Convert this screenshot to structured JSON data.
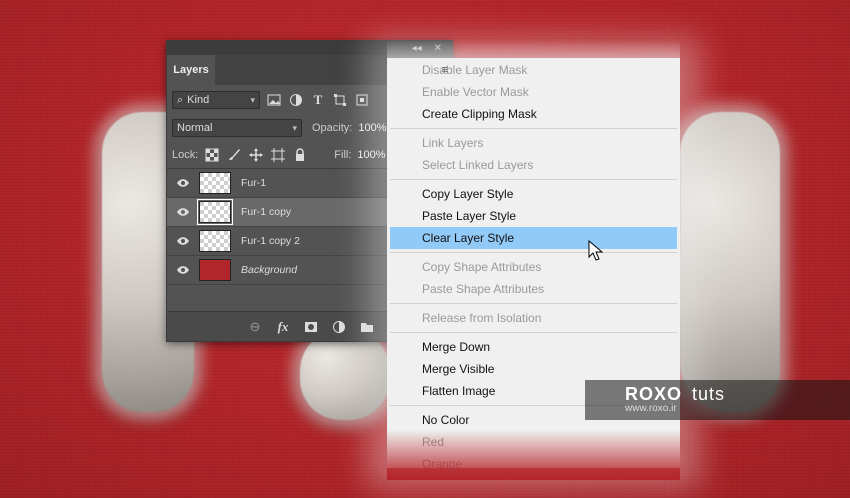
{
  "panel": {
    "title_tab": "Layers",
    "filter_kind": "Kind",
    "blend_mode": "Normal",
    "opacity_label": "Opacity:",
    "opacity_value": "100%",
    "lock_label": "Lock:",
    "fill_label": "Fill:",
    "fill_value": "100%",
    "layers": [
      {
        "name": "Fur-1",
        "thumb": "transparent",
        "selected": false,
        "italic": false
      },
      {
        "name": "Fur-1 copy",
        "thumb": "transparent",
        "selected": true,
        "italic": false
      },
      {
        "name": "Fur-1 copy 2",
        "thumb": "transparent",
        "selected": false,
        "italic": false
      },
      {
        "name": "Background",
        "thumb": "red",
        "selected": false,
        "italic": true
      }
    ]
  },
  "menu": {
    "items": [
      {
        "label": "Disable Layer Mask",
        "disabled": true
      },
      {
        "label": "Enable Vector Mask",
        "disabled": true
      },
      {
        "label": "Create Clipping Mask",
        "disabled": false
      },
      {
        "sep": true
      },
      {
        "label": "Link Layers",
        "disabled": true
      },
      {
        "label": "Select Linked Layers",
        "disabled": true
      },
      {
        "sep": true
      },
      {
        "label": "Copy Layer Style",
        "disabled": false
      },
      {
        "label": "Paste Layer Style",
        "disabled": false
      },
      {
        "label": "Clear Layer Style",
        "disabled": false,
        "highlighted": true
      },
      {
        "sep": true
      },
      {
        "label": "Copy Shape Attributes",
        "disabled": true
      },
      {
        "label": "Paste Shape Attributes",
        "disabled": true
      },
      {
        "sep": true
      },
      {
        "label": "Release from Isolation",
        "disabled": true
      },
      {
        "sep": true
      },
      {
        "label": "Merge Down",
        "disabled": false
      },
      {
        "label": "Merge Visible",
        "disabled": false
      },
      {
        "label": "Flatten Image",
        "disabled": false
      },
      {
        "sep": true
      },
      {
        "label": "No Color",
        "disabled": false
      },
      {
        "label": "Red",
        "disabled": true
      },
      {
        "label": "Orange",
        "disabled": true
      }
    ]
  },
  "watermark": {
    "brand": "ROXO",
    "brand_suffix": "tuts",
    "url": "www.roxo.ir"
  },
  "colors": {
    "background": "#b5252a",
    "panel": "#535353",
    "menu_highlight": "#91c9f7"
  }
}
